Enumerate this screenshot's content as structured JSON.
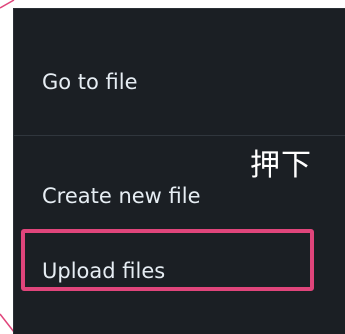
{
  "menu": {
    "items": [
      {
        "label": "Go to file"
      },
      {
        "label": "Create new file"
      },
      {
        "label": "Upload files"
      }
    ]
  },
  "annotation": {
    "text": "押下",
    "highlight_color": "#e0457b"
  }
}
